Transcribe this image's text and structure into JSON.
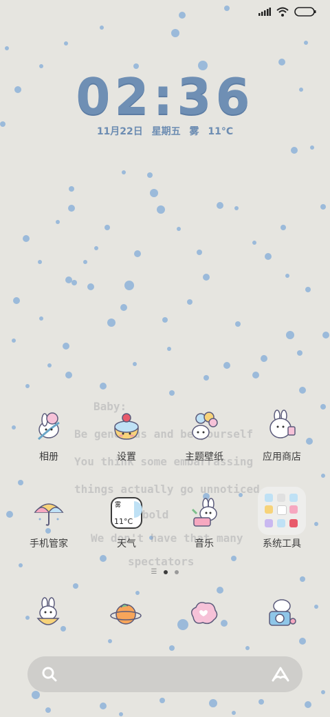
{
  "clock": {
    "time": "02:36"
  },
  "date": {
    "date": "11月22日",
    "weekday": "星期五",
    "weather": "雾",
    "temp": "11°C"
  },
  "quote": {
    "lines": [
      "Baby:",
      "Be generous and be yourself",
      "You think some embarrassing",
      "things actually go unnoticed",
      "Be bold",
      "We don't have that many",
      "spectators"
    ]
  },
  "apps": [
    {
      "label": "相册",
      "icon": "album-bunny-icon"
    },
    {
      "label": "设置",
      "icon": "settings-cake-icon"
    },
    {
      "label": "主题壁纸",
      "icon": "themes-balloon-icon"
    },
    {
      "label": "应用商店",
      "icon": "appstore-bunny-icon"
    },
    {
      "label": "手机管家",
      "icon": "security-umbrella-icon"
    },
    {
      "label": "天气",
      "icon": "weather-widget-icon"
    },
    {
      "label": "音乐",
      "icon": "music-drum-icon"
    },
    {
      "label": "系统工具",
      "icon": "system-tools-folder-icon"
    }
  ],
  "weather_widget": {
    "condition": "雾",
    "temp": "11°C"
  },
  "dock": [
    {
      "icon": "phone-bunny-icon"
    },
    {
      "icon": "browser-planet-icon"
    },
    {
      "icon": "messages-cloud-icon"
    },
    {
      "icon": "camera-bunny-icon"
    }
  ],
  "search": {
    "left_icon": "search-icon",
    "right_icon": "assistant-icon"
  },
  "colors": {
    "accent": "#6f8fb4",
    "background": "#e6e5e0",
    "speckle": "#8fb3d9"
  }
}
